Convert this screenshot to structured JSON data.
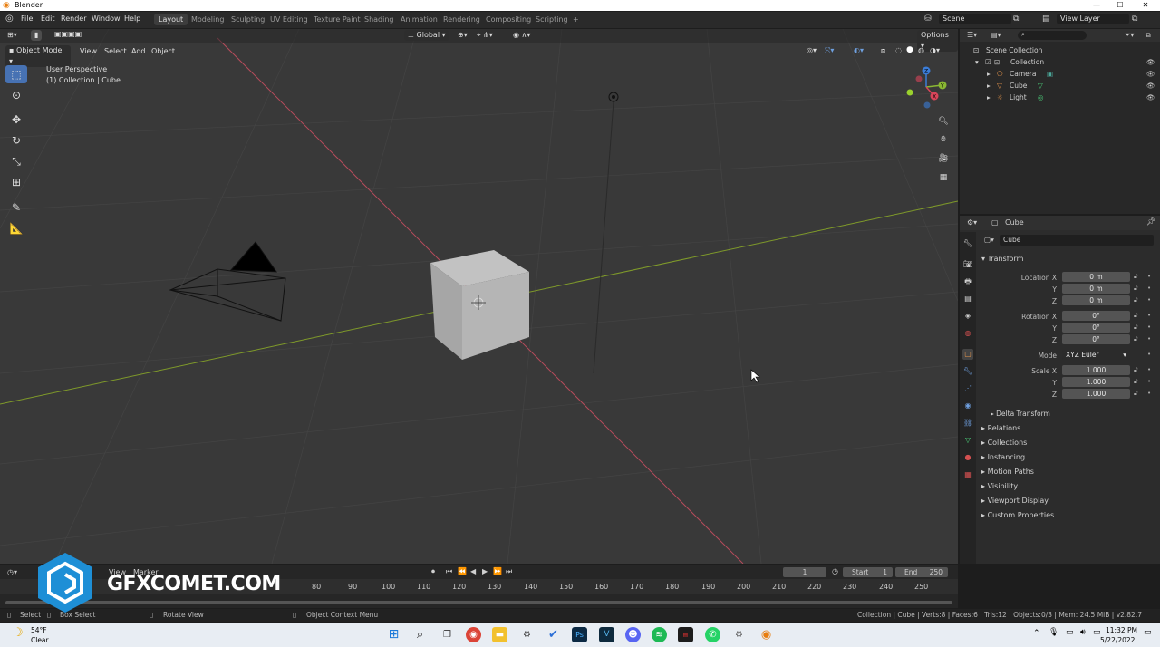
{
  "window": {
    "title": "Blender",
    "controls": [
      "—",
      "☐",
      "✕"
    ]
  },
  "menu": [
    "File",
    "Edit",
    "Render",
    "Window",
    "Help"
  ],
  "workspaces": [
    "Layout",
    "Modeling",
    "Sculpting",
    "UV Editing",
    "Texture Paint",
    "Shading",
    "Animation",
    "Rendering",
    "Compositing",
    "Scripting"
  ],
  "workspace_add": "+",
  "scene": {
    "label": "Scene",
    "view_layer": "View Layer"
  },
  "viewport": {
    "transform_orientation": "Global",
    "options_label": "Options",
    "mode": "Object Mode",
    "header_menus": [
      "View",
      "Select",
      "Add",
      "Object"
    ],
    "overlay_title": "User Perspective",
    "overlay_subtitle": "(1) Collection | Cube",
    "gizmo_axes": {
      "x": "X",
      "y": "Y",
      "z": "Z"
    },
    "colors": {
      "background": "#393939",
      "x_axis": "#b54b5b",
      "y_axis": "#7f9a2a",
      "grid": "#444444",
      "cube": "#b8b8b8"
    }
  },
  "outliner": {
    "search_placeholder": "",
    "items": [
      {
        "label": "Scene Collection",
        "indent": 0
      },
      {
        "label": "Collection",
        "indent": 1
      },
      {
        "label": "Camera",
        "indent": 2
      },
      {
        "label": "Cube",
        "indent": 2
      },
      {
        "label": "Light",
        "indent": 2
      }
    ]
  },
  "properties": {
    "object_name_header": "Cube",
    "object_name_field": "Cube",
    "transform_header": "Transform",
    "location": {
      "label": "Location X",
      "x": "0 m",
      "y": "0 m",
      "z": "0 m"
    },
    "rotation": {
      "label": "Rotation X",
      "x": "0°",
      "y": "0°",
      "z": "0°"
    },
    "mode": {
      "label": "Mode",
      "value": "XYZ Euler"
    },
    "scale": {
      "label": "Scale X",
      "x": "1.000",
      "y": "1.000",
      "z": "1.000"
    },
    "axis_labels": {
      "y": "Y",
      "z": "Z"
    },
    "delta_transform": "Delta Transform",
    "panels": [
      "Relations",
      "Collections",
      "Instancing",
      "Motion Paths",
      "Visibility",
      "Viewport Display",
      "Custom Properties"
    ]
  },
  "timeline": {
    "menus": [
      "View",
      "Marker"
    ],
    "current_frame": "1",
    "start_label": "Start",
    "start_value": "1",
    "end_label": "End",
    "end_value": "250",
    "ruler": [
      "80",
      "90",
      "100",
      "110",
      "120",
      "130",
      "140",
      "150",
      "160",
      "170",
      "180",
      "190",
      "200",
      "210",
      "220",
      "230",
      "240",
      "250"
    ]
  },
  "statusbar": {
    "select": "Select",
    "box_select": "Box Select",
    "rotate_view": "Rotate View",
    "context_menu": "Object Context Menu",
    "stats": "Collection | Cube | Verts:8 | Faces:6 | Tris:12 | Objects:0/3 | Mem: 24.5 MiB | v2.82.7"
  },
  "taskbar": {
    "weather_temp": "54°F",
    "weather_desc": "Clear",
    "time": "11:32 PM",
    "date": "5/22/2022"
  },
  "watermark": {
    "text": "GFXCOMET.COM"
  }
}
